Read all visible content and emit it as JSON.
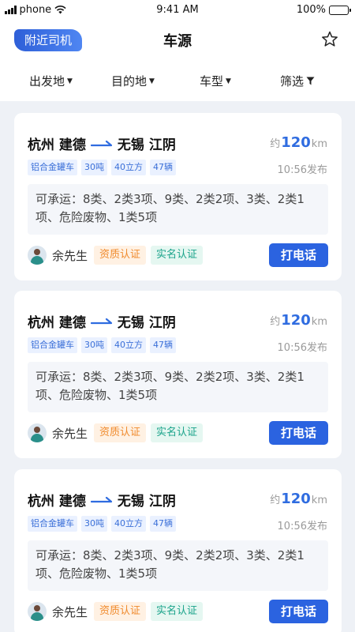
{
  "status_bar": {
    "carrier": "phone",
    "time": "9:41 AM",
    "battery": "100%"
  },
  "header": {
    "nearby_button": "附近司机",
    "title": "车源",
    "star_icon": "star-outline-icon"
  },
  "filters": [
    {
      "label": "出发地",
      "icon": "caret-down-icon"
    },
    {
      "label": "目的地",
      "icon": "caret-down-icon"
    },
    {
      "label": "车型",
      "icon": "caret-down-icon"
    },
    {
      "label": "筛选",
      "icon": "filter-funnel-icon"
    }
  ],
  "colors": {
    "accent": "#2b63e0",
    "badge_qual": "#f08a2c",
    "badge_real": "#1aa38a",
    "background": "#eef1f6"
  },
  "cards": [
    {
      "origin": "杭州 建德",
      "destination": "无锡 江阴",
      "distance_prefix": "约",
      "distance_value": "120",
      "distance_unit": "km",
      "tags": [
        "铝合金罐车",
        "30吨",
        "40立方",
        "47辆"
      ],
      "published": "10:56发布",
      "carry": "可承运：8类、2类3项、9类、2类2项、3类、2类1项、危险废物、1类5项",
      "owner": "余先生",
      "badge_qual": "资质认证",
      "badge_real": "实名认证",
      "call_label": "打电话"
    },
    {
      "origin": "杭州 建德",
      "destination": "无锡 江阴",
      "distance_prefix": "约",
      "distance_value": "120",
      "distance_unit": "km",
      "tags": [
        "铝合金罐车",
        "30吨",
        "40立方",
        "47辆"
      ],
      "published": "10:56发布",
      "carry": "可承运：8类、2类3项、9类、2类2项、3类、2类1项、危险废物、1类5项",
      "owner": "余先生",
      "badge_qual": "资质认证",
      "badge_real": "实名认证",
      "call_label": "打电话"
    },
    {
      "origin": "杭州 建德",
      "destination": "无锡 江阴",
      "distance_prefix": "约",
      "distance_value": "120",
      "distance_unit": "km",
      "tags": [
        "铝合金罐车",
        "30吨",
        "40立方",
        "47辆"
      ],
      "published": "10:56发布",
      "carry": "可承运：8类、2类3项、9类、2类2项、3类、2类1项、危险废物、1类5项",
      "owner": "余先生",
      "badge_qual": "资质认证",
      "badge_real": "实名认证",
      "call_label": "打电话"
    }
  ]
}
